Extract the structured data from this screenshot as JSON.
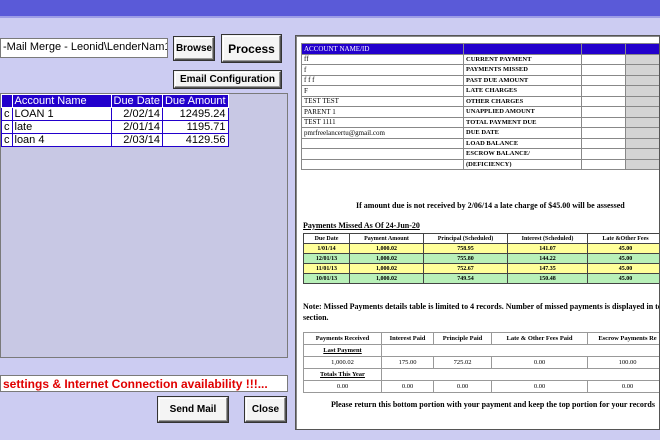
{
  "window": {
    "title_bar_color": "#5a5ad8",
    "background": "#ccccf2"
  },
  "toolbar": {
    "document_path": "-Mail Merge - Leonid\\LenderNam1.doc",
    "browse_label": "Browse",
    "process_label": "Process",
    "email_config_label": "Email Configuration"
  },
  "grid": {
    "columns": [
      "",
      "Account Name",
      "Due Date",
      "Due Amount"
    ],
    "rows": [
      {
        "c0": "c",
        "name": "LOAN 1",
        "due_date": "2/02/14",
        "due_amount": "12495.24"
      },
      {
        "c0": "c",
        "name": "late",
        "due_date": "2/01/14",
        "due_amount": "1195.71"
      },
      {
        "c0": "c",
        "name": "loan 4",
        "due_date": "2/03/14",
        "due_amount": "4129.56"
      }
    ]
  },
  "status": {
    "message": "settings & Internet Connection availability !!!...",
    "color": "#e00000"
  },
  "actions": {
    "send_label": "Send Mail",
    "close_label": "Close"
  },
  "preview": {
    "account_header": "ACCOUNT NAME/ID",
    "left_values": [
      "ff",
      "f",
      "f f f",
      "F",
      "TEST TEST",
      "PARENT 1",
      "TEST 1111",
      "pmrfreelancertu@gmail.com",
      "",
      "",
      ""
    ],
    "right_labels": [
      "CURRENT PAYMENT",
      "PAYMENTS MISSED",
      "PAST DUE AMOUNT",
      "LATE CHARGES",
      "OTHER CHARGES",
      "UNAPPLIED AMOUNT",
      "TOTAL PAYMENT DUE",
      "DUE DATE",
      "LOAD BALANCE",
      "ESCROW BALANCE/",
      "(DEFICIENCY)"
    ],
    "late_note": "If amount due is not received by 2/06/14 a late charge of $45.00 will be assessed",
    "missed_title": "Payments Missed As Of 24-Jun-20",
    "missed_columns": [
      "Due Date",
      "Payment Amount",
      "Principal (Scheduled)",
      "Interest (Scheduled)",
      "Late &Other Fees"
    ],
    "missed_rows": [
      [
        "1/01/14",
        "1,000.02",
        "758.95",
        "141.07",
        "45.00"
      ],
      [
        "12/01/13",
        "1,000.02",
        "755.80",
        "144.22",
        "45.00"
      ],
      [
        "11/01/13",
        "1,000.02",
        "752.67",
        "147.35",
        "45.00"
      ],
      [
        "10/01/13",
        "1,000.02",
        "749.54",
        "150.48",
        "45.00"
      ]
    ],
    "missed_note": "Note: Missed Payments details table is limited to 4 records. Number of missed payments is displayed in top section.",
    "pay_columns": [
      "Payments Received",
      "Interest Paid",
      "Principle Paid",
      "Late & Other Fees Paid",
      "Escrow Payments Re"
    ],
    "last_payment_label": "Last Payment",
    "last_payment_values": [
      "1,000.02",
      "175.00",
      "725.02",
      "0.00",
      "100.00"
    ],
    "totals_label": "Totals This Year",
    "totals_values": [
      "0.00",
      "0.00",
      "0.00",
      "0.00",
      "0.00"
    ],
    "return_note": "Please return this bottom portion with your payment and keep the top portion for your records"
  }
}
